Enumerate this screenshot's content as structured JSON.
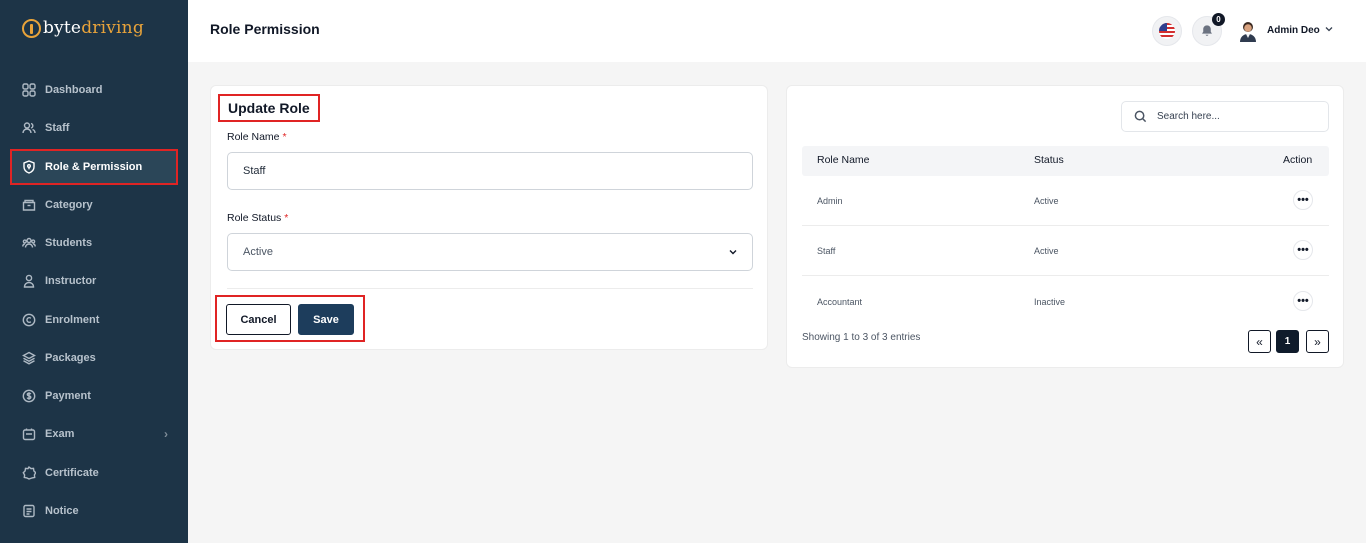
{
  "brand": {
    "part1": "byte",
    "part2": "driving",
    "accent_color": "#e8a33a"
  },
  "sidebar": {
    "items": [
      {
        "label": "Dashboard",
        "icon": "grid-icon"
      },
      {
        "label": "Staff",
        "icon": "users-icon"
      },
      {
        "label": "Role & Permission",
        "icon": "shield-icon",
        "active": true
      },
      {
        "label": "Category",
        "icon": "folder-icon"
      },
      {
        "label": "Students",
        "icon": "people-icon"
      },
      {
        "label": "Instructor",
        "icon": "user-icon"
      },
      {
        "label": "Enrolment",
        "icon": "copyright-icon"
      },
      {
        "label": "Packages",
        "icon": "layers-icon"
      },
      {
        "label": "Payment",
        "icon": "dollar-icon"
      },
      {
        "label": "Exam",
        "icon": "exam-icon",
        "has_submenu": true
      },
      {
        "label": "Certificate",
        "icon": "badge-icon"
      },
      {
        "label": "Notice",
        "icon": "document-icon"
      }
    ]
  },
  "header": {
    "title": "Role Permission",
    "notification_count": "0",
    "user_name": "Admin Deo"
  },
  "form": {
    "title": "Update Role",
    "role_name_label": "Role Name",
    "required_mark": "*",
    "role_name_value": "Staff",
    "role_status_label": "Role Status",
    "role_status_value": "Active",
    "cancel_label": "Cancel",
    "save_label": "Save"
  },
  "table": {
    "search_placeholder": "Search here...",
    "columns": [
      "Role Name",
      "Status",
      "Action"
    ],
    "rows": [
      {
        "name": "Admin",
        "status": "Active",
        "action": "•••"
      },
      {
        "name": "Staff",
        "status": "Active",
        "action": "•••"
      },
      {
        "name": "Accountant",
        "status": "Inactive",
        "action": "•••"
      }
    ],
    "showing_text": "Showing 1 to 3 of 3 entries",
    "pagination": {
      "prev": "«",
      "current": "1",
      "next": "»"
    }
  }
}
